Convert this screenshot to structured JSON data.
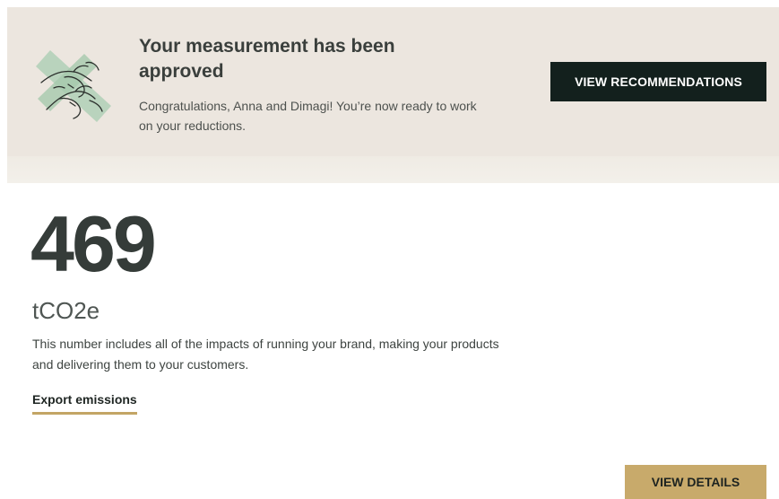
{
  "banner": {
    "illustration_icon": "hands-together-icon",
    "title": "Your measurement has been approved",
    "message": "Congratulations, Anna and Dimagi! You’re now ready to work on your reductions.",
    "recommendations_button": "VIEW RECOMMENDATIONS",
    "colors": {
      "background": "#ece6df",
      "button": "#13201d"
    }
  },
  "emissions": {
    "value": "469",
    "unit": "tCO2e",
    "description": "This number includes all of the impacts of running your brand, making your products and delivering them to your customers.",
    "export_link": "Export emissions",
    "details_button": "VIEW DETAILS",
    "colors": {
      "accent": "#c8aa6b"
    }
  }
}
